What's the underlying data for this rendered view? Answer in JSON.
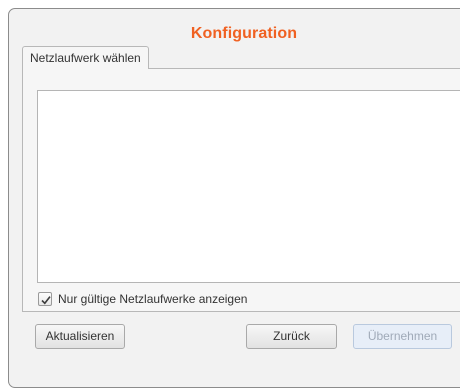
{
  "window": {
    "title": "Konfiguration"
  },
  "tabs": [
    {
      "label": "Netzlaufwerk wählen",
      "selected": true
    }
  ],
  "drive_list": {
    "items": []
  },
  "options": {
    "only_valid_label": "Nur gültige Netzlaufwerke anzeigen",
    "only_valid_checked": true
  },
  "buttons": {
    "refresh_label": "Aktualisieren",
    "back_label": "Zurück",
    "apply_label": "Übernehmen",
    "apply_enabled": false
  },
  "colors": {
    "title_accent": "#f06122",
    "disabled_button_bg": "#e7eef8"
  }
}
